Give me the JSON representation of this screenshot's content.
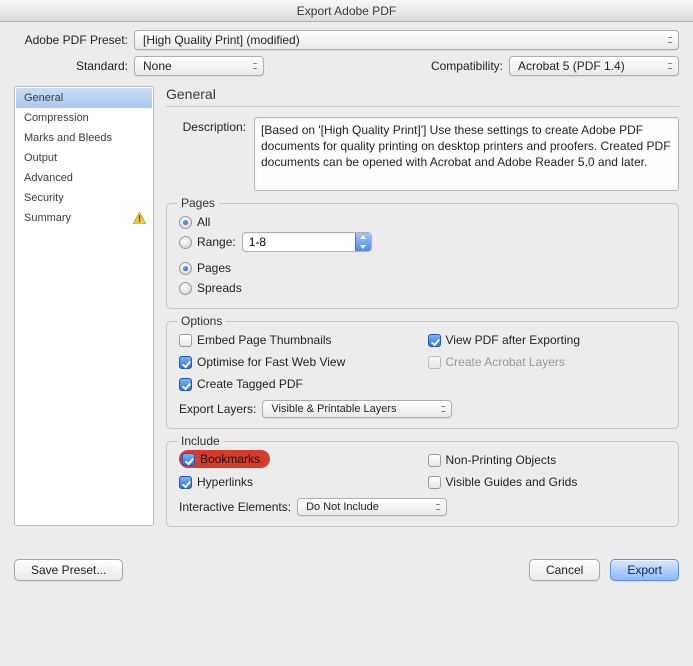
{
  "window": {
    "title": "Export Adobe PDF"
  },
  "top": {
    "preset_label": "Adobe PDF Preset:",
    "preset_value": "[High Quality Print] (modified)",
    "standard_label": "Standard:",
    "standard_value": "None",
    "compat_label": "Compatibility:",
    "compat_value": "Acrobat 5 (PDF 1.4)"
  },
  "sidebar": {
    "items": [
      "General",
      "Compression",
      "Marks and Bleeds",
      "Output",
      "Advanced",
      "Security",
      "Summary"
    ],
    "selected_index": 0,
    "warning_index": 6
  },
  "general": {
    "heading": "General",
    "description_label": "Description:",
    "description_text": "[Based on '[High Quality Print]'] Use these settings to create Adobe PDF documents for quality printing on desktop printers and proofers.  Created PDF documents can be opened with Acrobat and Adobe Reader 5.0 and later."
  },
  "pages": {
    "legend": "Pages",
    "all": "All",
    "range": "Range:",
    "range_value": "1-8",
    "pages": "Pages",
    "spreads": "Spreads"
  },
  "options": {
    "legend": "Options",
    "thumbnails": "Embed Page Thumbnails",
    "view_after": "View PDF after Exporting",
    "optimise": "Optimise for Fast Web View",
    "acro_layers": "Create Acrobat Layers",
    "tagged": "Create Tagged PDF",
    "export_layers_label": "Export Layers:",
    "export_layers_value": "Visible & Printable Layers"
  },
  "include": {
    "legend": "Include",
    "bookmarks": "Bookmarks",
    "nonprinting": "Non-Printing Objects",
    "hyperlinks": "Hyperlinks",
    "guides": "Visible Guides and Grids",
    "interactive_label": "Interactive Elements:",
    "interactive_value": "Do Not Include"
  },
  "footer": {
    "save_preset": "Save Preset...",
    "cancel": "Cancel",
    "export": "Export"
  }
}
